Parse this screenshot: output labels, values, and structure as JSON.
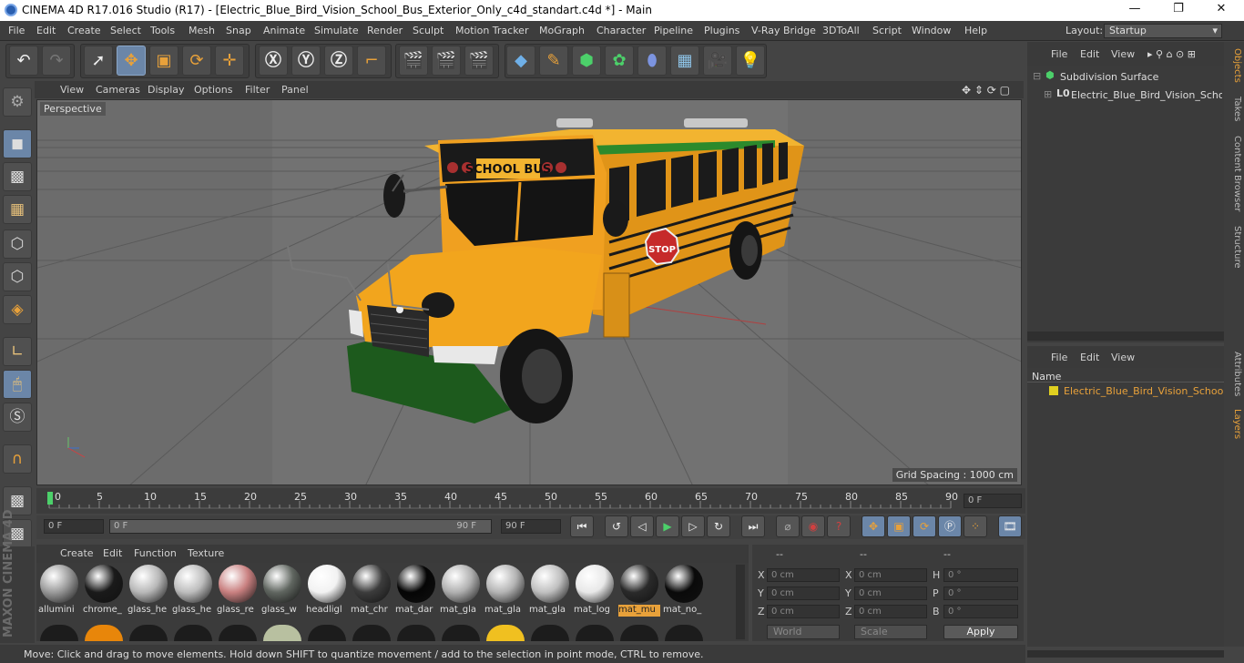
{
  "window": {
    "title": "CINEMA 4D R17.016 Studio (R17) - [Electric_Blue_Bird_Vision_School_Bus_Exterior_Only_c4d_standart.c4d *] - Main",
    "min": "—",
    "max": "❐",
    "close": "✕"
  },
  "menu": [
    "File",
    "Edit",
    "Create",
    "Select",
    "Tools",
    "Mesh",
    "Snap",
    "Animate",
    "Simulate",
    "Render",
    "Sculpt",
    "Motion Tracker",
    "MoGraph",
    "Character",
    "Pipeline",
    "Plugins",
    "V-Ray Bridge",
    "3DToAll",
    "Script",
    "Window",
    "Help"
  ],
  "layout": {
    "label": "Layout:",
    "value": "Startup"
  },
  "viewport": {
    "menu": [
      "View",
      "Cameras",
      "Display",
      "Options",
      "Filter",
      "Panel"
    ],
    "label": "Perspective",
    "grid_spacing": "Grid Spacing : 1000 cm",
    "sign": "SCHOOL BUS",
    "stop": "STOP"
  },
  "timeline": {
    "ticks": [
      "0",
      "5",
      "10",
      "15",
      "20",
      "25",
      "30",
      "35",
      "40",
      "45",
      "50",
      "55",
      "60",
      "65",
      "70",
      "75",
      "80",
      "85",
      "90"
    ],
    "current_frame": "0 F",
    "start": "0 F",
    "slider_start": "0 F",
    "slider_end": "90 F",
    "end": "90 F"
  },
  "materials": {
    "menu": [
      "Create",
      "Edit",
      "Function",
      "Texture"
    ],
    "items": [
      {
        "name": "allumini",
        "color": "#9a9a9a"
      },
      {
        "name": "chrome_",
        "color": "#1a1a1a"
      },
      {
        "name": "glass_he",
        "color": "#b8b8b8"
      },
      {
        "name": "glass_he",
        "color": "#bdbdbd"
      },
      {
        "name": "glass_re",
        "color": "#c98080"
      },
      {
        "name": "glass_w",
        "color": "#606660"
      },
      {
        "name": "headligl",
        "color": "#f2f2f2"
      },
      {
        "name": "mat_chr",
        "color": "#3c3c3c"
      },
      {
        "name": "mat_dar",
        "color": "#050505"
      },
      {
        "name": "mat_gla",
        "color": "#b0b0b0"
      },
      {
        "name": "mat_gla",
        "color": "#b4b4b4"
      },
      {
        "name": "mat_gla",
        "color": "#c0c0c0"
      },
      {
        "name": "mat_log",
        "color": "#e8e8e8"
      },
      {
        "name": "mat_mu",
        "color": "#2a2a2a",
        "active": true
      },
      {
        "name": "mat_no_",
        "color": "#0a0a0a"
      }
    ]
  },
  "coords": {
    "headers": [
      "--",
      "--",
      "--"
    ],
    "rows": [
      {
        "a": "X",
        "av": "0 cm",
        "b": "X",
        "bv": "0 cm",
        "c": "H",
        "cv": "0 °"
      },
      {
        "a": "Y",
        "av": "0 cm",
        "b": "Y",
        "bv": "0 cm",
        "c": "P",
        "cv": "0 °"
      },
      {
        "a": "Z",
        "av": "0 cm",
        "b": "Z",
        "bv": "0 cm",
        "c": "B",
        "cv": "0 °"
      }
    ],
    "space": "World",
    "mode": "Scale",
    "apply": "Apply"
  },
  "objects": {
    "menu": [
      "File",
      "Edit",
      "View"
    ],
    "items": [
      "Subdivision Surface",
      "Electric_Blue_Bird_Vision_School_"
    ]
  },
  "layers": {
    "menu": [
      "File",
      "Edit",
      "View"
    ],
    "header": "Name",
    "items": [
      "Electric_Blue_Bird_Vision_School_E"
    ]
  },
  "sidetabs": [
    "Objects",
    "Takes",
    "Content Browser",
    "Structure",
    "Attributes",
    "Layers"
  ],
  "status": "Move: Click and drag to move elements. Hold down SHIFT to quantize movement / add to the selection in point mode, CTRL to remove.",
  "logo": "MAXON CINEMA 4D",
  "colors": {
    "accent": "#e8a13a",
    "selected": "#6b86a8",
    "bus": "#f0a020"
  }
}
